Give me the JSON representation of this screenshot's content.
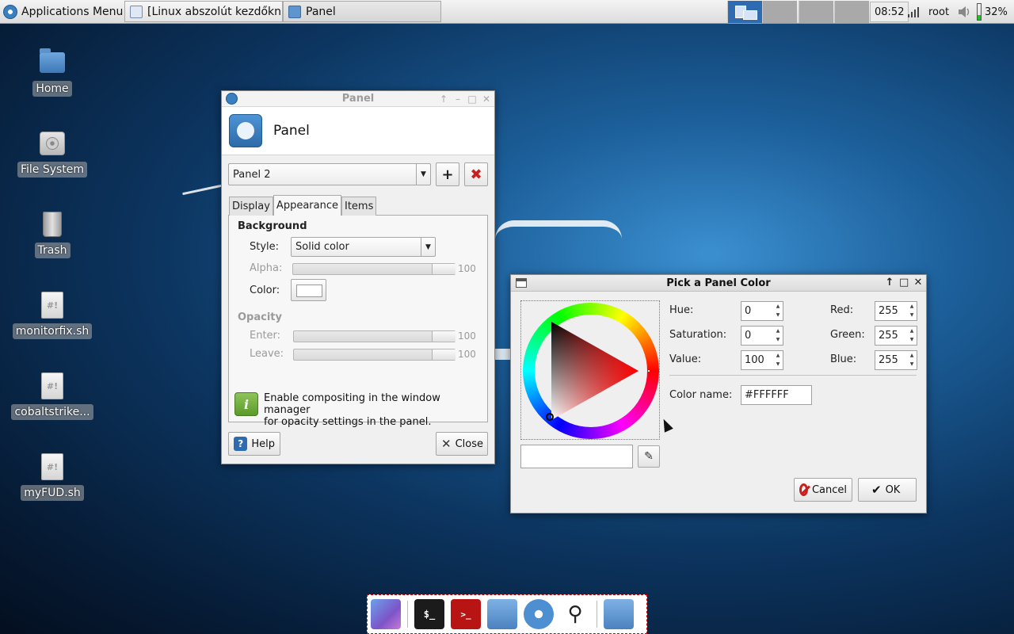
{
  "top_panel": {
    "apps_menu_label": "Applications Menu",
    "tasks": [
      {
        "label": "[Linux abszolút kezdőkn..."
      },
      {
        "label": "Panel"
      }
    ],
    "clock": "08:52",
    "user": "root",
    "battery": "32%"
  },
  "desktop": {
    "icons": [
      {
        "label": "Home",
        "icon": "home-folder-icon"
      },
      {
        "label": "File System",
        "icon": "drive-icon"
      },
      {
        "label": "Trash",
        "icon": "trash-icon"
      },
      {
        "label": "monitorfix.sh",
        "icon": "script-icon"
      },
      {
        "label": "cobaltstrike...",
        "icon": "script-icon"
      },
      {
        "label": "myFUD.sh",
        "icon": "script-icon"
      }
    ],
    "script_glyph": "#!"
  },
  "panel_window": {
    "title": "Panel",
    "header_title": "Panel",
    "panel_select": "Panel 2",
    "add_label": "+",
    "remove_label": "✖",
    "tabs": [
      {
        "label": "Display"
      },
      {
        "label": "Appearance"
      },
      {
        "label": "Items"
      }
    ],
    "background_section": "Background",
    "style_label": "Style:",
    "style_value": "Solid color",
    "alpha_label": "Alpha:",
    "alpha_value": "100",
    "color_label": "Color:",
    "opacity_section": "Opacity",
    "enter_label": "Enter:",
    "enter_value": "100",
    "leave_label": "Leave:",
    "leave_value": "100",
    "info_line1": "Enable compositing in the window manager",
    "info_line2": "for opacity settings in the panel.",
    "help_label": "Help",
    "close_label": "Close"
  },
  "color_dialog": {
    "title": "Pick a Panel Color",
    "hue_label": "Hue:",
    "hue_value": "0",
    "saturation_label": "Saturation:",
    "saturation_value": "0",
    "value_label": "Value:",
    "value_value": "100",
    "red_label": "Red:",
    "red_value": "255",
    "green_label": "Green:",
    "green_value": "255",
    "blue_label": "Blue:",
    "blue_value": "255",
    "color_name_label": "Color name:",
    "color_name_value": "#FFFFFF",
    "cancel_label": "Cancel",
    "ok_label": "OK",
    "selected_color": "#FFFFFF"
  },
  "dock": {
    "terminal_glyph": "$_",
    "cs_glyph": ">_"
  },
  "colors": {
    "accent": "#2f6bb1",
    "cancel_red": "#c8201e"
  }
}
